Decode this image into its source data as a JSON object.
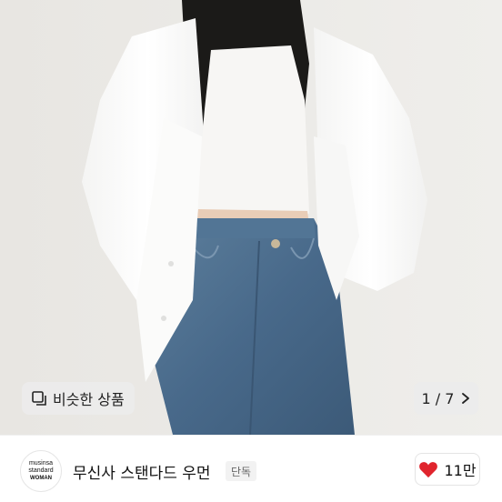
{
  "gallery": {
    "similar_label": "비슷한 상품",
    "similar_icon": "similar-items-icon",
    "page_indicator": "1 / 7",
    "next_icon": "chevron-right-icon"
  },
  "brand": {
    "logo_line1": "musinsa",
    "logo_line2": "standard",
    "logo_line3": "WOMAN",
    "name": "무신사 스탠다드 우먼",
    "badge": "단독"
  },
  "like": {
    "icon": "heart-icon",
    "count": "11만",
    "color": "#e0242d"
  }
}
